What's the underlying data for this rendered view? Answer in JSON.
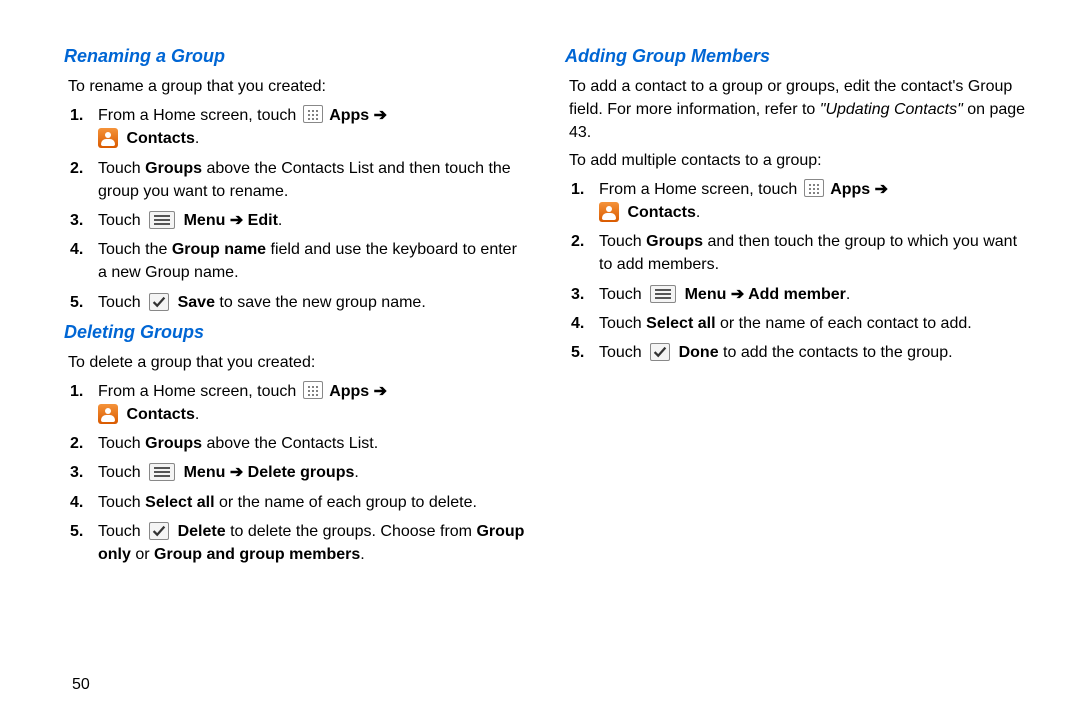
{
  "page_number": "50",
  "left": {
    "sec1": {
      "title": "Renaming a Group",
      "intro": "To rename a group that you created:",
      "s1_a": "From a Home screen, touch ",
      "apps": "Apps",
      "arrow": " ➔",
      "contacts": "Contacts",
      "period": ".",
      "s2_a": "Touch ",
      "s2_b": "Groups",
      "s2_c": " above the Contacts List and then touch the group you want to rename.",
      "s3_a": "Touch ",
      "s3_menu": "Menu",
      "s3_arrow": " ➔ ",
      "s3_edit": "Edit",
      "s3_end": ".",
      "s4_a": "Touch the ",
      "s4_b": "Group name",
      "s4_c": " field and use the keyboard to enter a new Group name.",
      "s5_a": "Touch ",
      "s5_b": "Save",
      "s5_c": " to save the new group name."
    },
    "sec2": {
      "title": "Deleting Groups",
      "intro": "To delete a group that you created:",
      "s2_a": "Touch ",
      "s2_b": "Groups",
      "s2_c": " above the Contacts List.",
      "s3_a": "Touch ",
      "s3_menu": "Menu",
      "s3_arrow": " ➔ ",
      "s3_del": "Delete groups",
      "s3_end": ".",
      "s4_a": "Touch ",
      "s4_b": "Select all",
      "s4_c": " or the name of each group to delete.",
      "s5_a": "Touch ",
      "s5_b": "Delete",
      "s5_c": " to delete the groups. Choose from ",
      "s5_d": "Group only",
      "s5_e": " or ",
      "s5_f": "Group and group members",
      "s5_g": "."
    }
  },
  "right": {
    "sec1": {
      "title": "Adding Group Members",
      "intro_a": "To add a contact to a group or groups, edit the contact's Group field. For more information, refer to ",
      "intro_b": "\"Updating Contacts\"",
      "intro_c": "  on page 43.",
      "intro2": "To add multiple contacts to a group:",
      "s2_a": "Touch ",
      "s2_b": "Groups",
      "s2_c": " and then touch the group to which you want to add members.",
      "s3_a": "Touch ",
      "s3_menu": "Menu",
      "s3_arrow": " ➔ ",
      "s3_add": "Add member",
      "s3_end": ".",
      "s4_a": "Touch ",
      "s4_b": "Select all",
      "s4_c": " or the name of each contact to add.",
      "s5_a": "Touch ",
      "s5_b": "Done",
      "s5_c": " to add the contacts to the group."
    }
  },
  "nums": {
    "n1": "1.",
    "n2": "2.",
    "n3": "3.",
    "n4": "4.",
    "n5": "5."
  }
}
